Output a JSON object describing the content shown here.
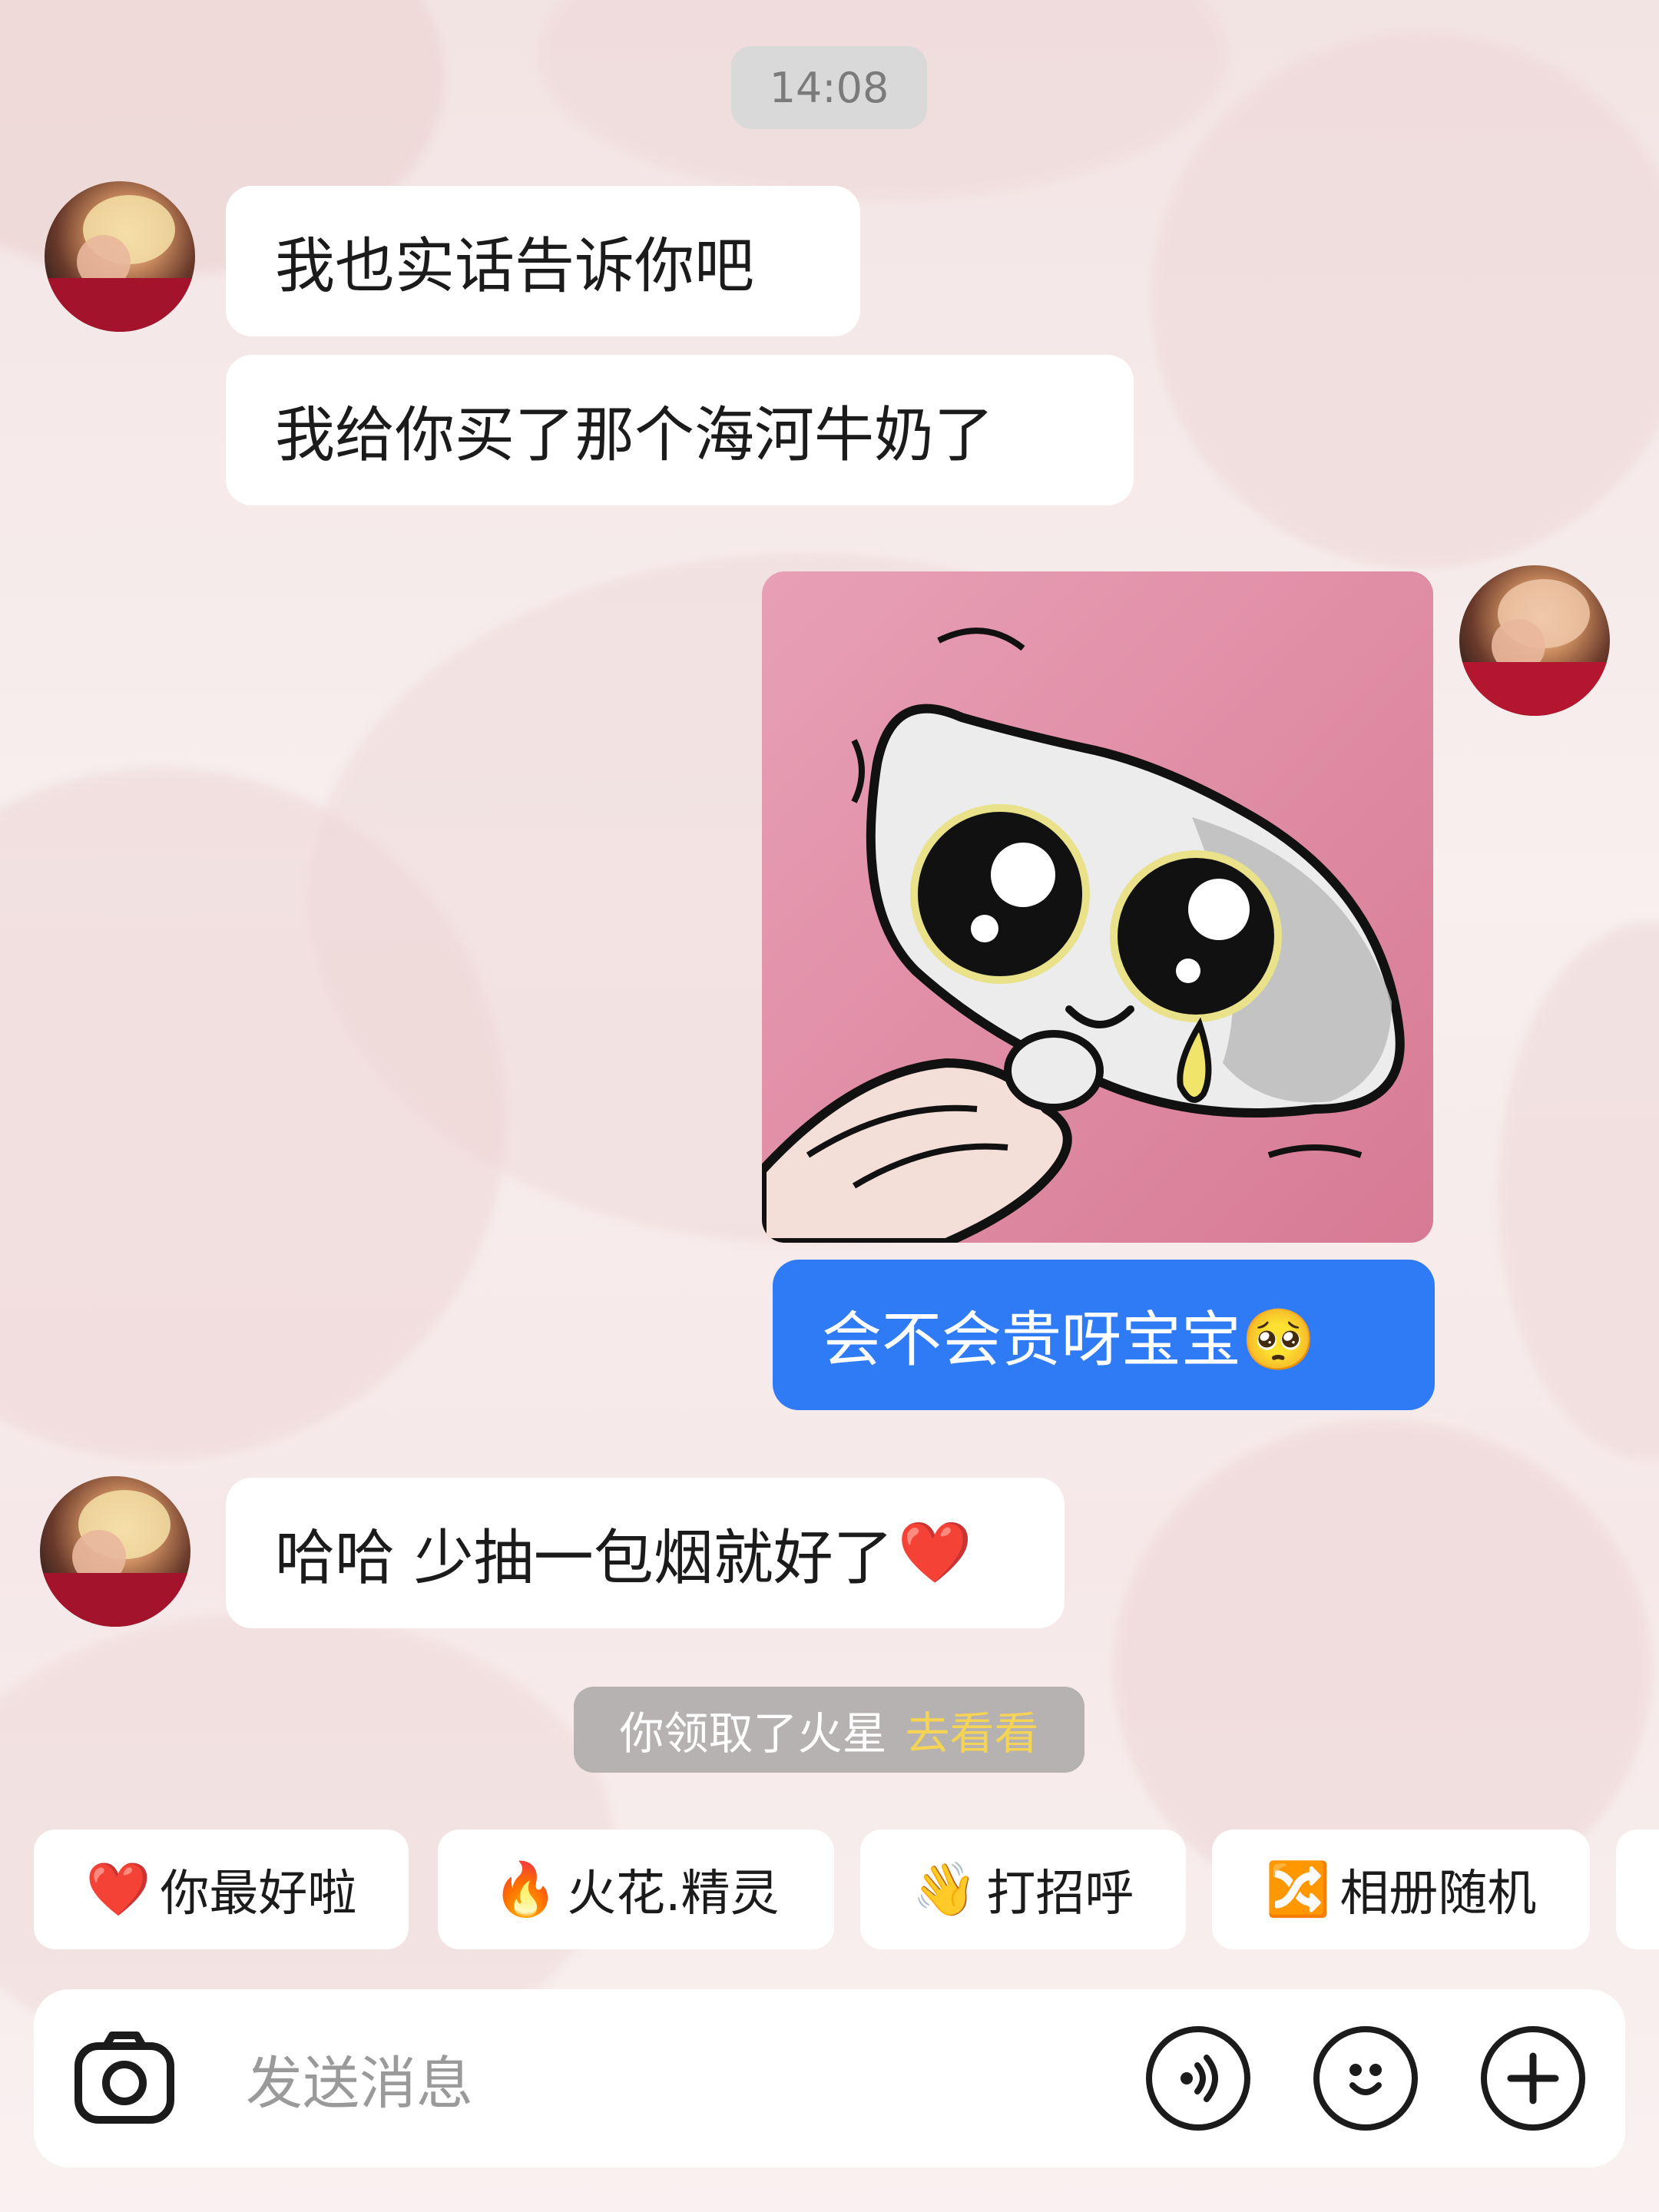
{
  "timestamp": "14:08",
  "messages": {
    "received_1": "我也实话告诉你吧",
    "received_2": "我给你买了那个海河牛奶了",
    "sent_text": "会不会贵呀宝宝🥺",
    "received_3": "哈哈 少抽一包烟就好了",
    "received_3_emoji": "❤️"
  },
  "system_notice": {
    "text": "你领取了火星",
    "link": "去看看"
  },
  "quick_replies": [
    {
      "emoji": "❤️",
      "label": "你最好啦"
    },
    {
      "emoji": "🔥",
      "label": "火花.精灵"
    },
    {
      "emoji": "👋",
      "label": "打招呼"
    },
    {
      "emoji": "🔀",
      "label": "相册随机"
    }
  ],
  "composer": {
    "placeholder": "发送消息",
    "icons": [
      "camera-icon",
      "voice-icon",
      "emoji-icon",
      "plus-icon"
    ]
  },
  "colors": {
    "sent_bubble": "#2f7bf5",
    "received_bubble": "#ffffff",
    "link": "#f5d354",
    "sticker_bg": "#e696ad"
  }
}
